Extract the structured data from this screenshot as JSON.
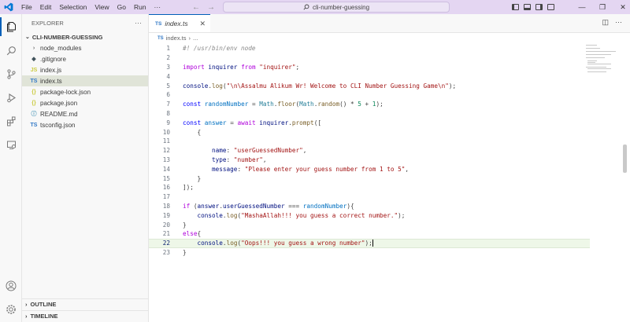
{
  "menu": [
    "File",
    "Edit",
    "Selection",
    "View",
    "Go",
    "Run",
    "···"
  ],
  "search": {
    "text": "cli-number-guessing"
  },
  "sidebar": {
    "header": "EXPLORER",
    "more": "···",
    "folder": "CLI-NUMBER-GUESSING",
    "items": [
      {
        "label": "node_modules",
        "icon": "›",
        "color": "#6f6f6f"
      },
      {
        "label": ".gitignore",
        "icon": "◆",
        "color": "#41535b"
      },
      {
        "label": "index.js",
        "icon": "JS",
        "color": "#cbcb41"
      },
      {
        "label": "index.ts",
        "icon": "TS",
        "color": "#3178c6"
      },
      {
        "label": "package-lock.json",
        "icon": "{}",
        "color": "#cbcb41"
      },
      {
        "label": "package.json",
        "icon": "{}",
        "color": "#cbcb41"
      },
      {
        "label": "README.md",
        "icon": "ⓘ",
        "color": "#519aba"
      },
      {
        "label": "tsconfig.json",
        "icon": "TS",
        "color": "#3178c6"
      }
    ],
    "outline": "OUTLINE",
    "timeline": "TIMELINE"
  },
  "tab": {
    "icon": "TS",
    "label": "index.ts",
    "close": "✕"
  },
  "breadcrumb": {
    "icon": "TS",
    "file": "index.ts",
    "sep": "›",
    "rest": "..."
  },
  "code": {
    "lines": [
      [
        {
          "t": "#! /usr/bin/env node",
          "c": "#8a8a8a",
          "i": true
        }
      ],
      [],
      [
        {
          "t": "import",
          "c": "#af00db"
        },
        {
          "t": " inquirer ",
          "c": "#001080"
        },
        {
          "t": "from",
          "c": "#af00db"
        },
        {
          "t": " ",
          "c": "#3b3b3b"
        },
        {
          "t": "\"inquirer\"",
          "c": "#a31515"
        },
        {
          "t": ";",
          "c": "#3b3b3b"
        }
      ],
      [],
      [
        {
          "t": "console",
          "c": "#001080"
        },
        {
          "t": ".",
          "c": "#3b3b3b"
        },
        {
          "t": "log",
          "c": "#795e26"
        },
        {
          "t": "(",
          "c": "#3b3b3b"
        },
        {
          "t": "\"\\n\\Assalmu Alikum Wr! Welcome to CLI Number Guessing Game\\n\"",
          "c": "#a31515"
        },
        {
          "t": ");",
          "c": "#3b3b3b"
        }
      ],
      [],
      [
        {
          "t": "const",
          "c": "#0000ff"
        },
        {
          "t": " randomNumber ",
          "c": "#0070c1"
        },
        {
          "t": "= ",
          "c": "#3b3b3b"
        },
        {
          "t": "Math",
          "c": "#267f99"
        },
        {
          "t": ".",
          "c": "#3b3b3b"
        },
        {
          "t": "floor",
          "c": "#795e26"
        },
        {
          "t": "(",
          "c": "#3b3b3b"
        },
        {
          "t": "Math",
          "c": "#267f99"
        },
        {
          "t": ".",
          "c": "#3b3b3b"
        },
        {
          "t": "random",
          "c": "#795e26"
        },
        {
          "t": "() * ",
          "c": "#3b3b3b"
        },
        {
          "t": "5",
          "c": "#098658"
        },
        {
          "t": " + ",
          "c": "#3b3b3b"
        },
        {
          "t": "1",
          "c": "#098658"
        },
        {
          "t": ");",
          "c": "#3b3b3b"
        }
      ],
      [],
      [
        {
          "t": "const",
          "c": "#0000ff"
        },
        {
          "t": " answer ",
          "c": "#0070c1"
        },
        {
          "t": "= ",
          "c": "#3b3b3b"
        },
        {
          "t": "await",
          "c": "#af00db"
        },
        {
          "t": " inquirer",
          "c": "#001080"
        },
        {
          "t": ".",
          "c": "#3b3b3b"
        },
        {
          "t": "prompt",
          "c": "#795e26"
        },
        {
          "t": "([",
          "c": "#3b3b3b"
        }
      ],
      [
        {
          "t": "    {",
          "c": "#3b3b3b"
        }
      ],
      [],
      [
        {
          "t": "        name",
          "c": "#001080"
        },
        {
          "t": ": ",
          "c": "#3b3b3b"
        },
        {
          "t": "\"userGuessedNumber\"",
          "c": "#a31515"
        },
        {
          "t": ",",
          "c": "#3b3b3b"
        }
      ],
      [
        {
          "t": "        type",
          "c": "#001080"
        },
        {
          "t": ": ",
          "c": "#3b3b3b"
        },
        {
          "t": "\"number\"",
          "c": "#a31515"
        },
        {
          "t": ",",
          "c": "#3b3b3b"
        }
      ],
      [
        {
          "t": "        message",
          "c": "#001080"
        },
        {
          "t": ": ",
          "c": "#3b3b3b"
        },
        {
          "t": "\"Please enter your guess number from 1 to 5\"",
          "c": "#a31515"
        },
        {
          "t": ",",
          "c": "#3b3b3b"
        }
      ],
      [
        {
          "t": "    }",
          "c": "#3b3b3b"
        }
      ],
      [
        {
          "t": "]);",
          "c": "#3b3b3b"
        }
      ],
      [],
      [
        {
          "t": "if",
          "c": "#af00db"
        },
        {
          "t": " (",
          "c": "#3b3b3b"
        },
        {
          "t": "answer",
          "c": "#001080"
        },
        {
          "t": ".",
          "c": "#3b3b3b"
        },
        {
          "t": "userGuessedNumber",
          "c": "#001080"
        },
        {
          "t": " === ",
          "c": "#3b3b3b"
        },
        {
          "t": "randomNumber",
          "c": "#0070c1"
        },
        {
          "t": "){",
          "c": "#3b3b3b"
        }
      ],
      [
        {
          "t": "    console",
          "c": "#001080"
        },
        {
          "t": ".",
          "c": "#3b3b3b"
        },
        {
          "t": "log",
          "c": "#795e26"
        },
        {
          "t": "(",
          "c": "#3b3b3b"
        },
        {
          "t": "\"MashaAllah!!! you guess a correct number.\"",
          "c": "#a31515"
        },
        {
          "t": ");",
          "c": "#3b3b3b"
        }
      ],
      [
        {
          "t": "}",
          "c": "#3b3b3b"
        }
      ],
      [
        {
          "t": "else",
          "c": "#af00db"
        },
        {
          "t": "{",
          "c": "#3b3b3b"
        }
      ],
      [
        {
          "t": "    console",
          "c": "#001080"
        },
        {
          "t": ".",
          "c": "#3b3b3b"
        },
        {
          "t": "log",
          "c": "#795e26"
        },
        {
          "t": "(",
          "c": "#3b3b3b"
        },
        {
          "t": "\"Oops!!! you guess a wrong number\"",
          "c": "#a31515"
        },
        {
          "t": ");",
          "c": "#3b3b3b"
        }
      ],
      [
        {
          "t": "}",
          "c": "#3b3b3b"
        }
      ]
    ],
    "active_line": 22
  },
  "colors": {
    "accent": "#005fb8",
    "titlebar": "#e4d6f2"
  }
}
